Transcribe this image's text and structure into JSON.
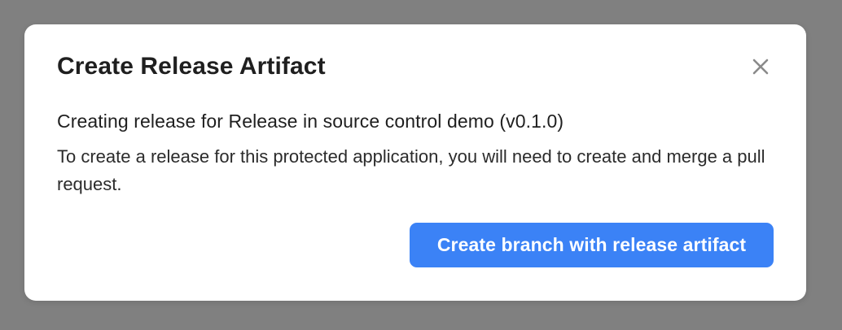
{
  "modal": {
    "title": "Create Release Artifact",
    "subtitle": "Creating release for Release in source control demo (v0.1.0)",
    "body": "To create a release for this protected application, you will need to create and merge a pull request.",
    "primary_button_label": "Create branch with release artifact",
    "close_icon": "close-icon"
  },
  "colors": {
    "backdrop": "#808080",
    "modal_background": "#ffffff",
    "primary_button": "#3b82f6",
    "close_icon": "#8a8a8a"
  }
}
